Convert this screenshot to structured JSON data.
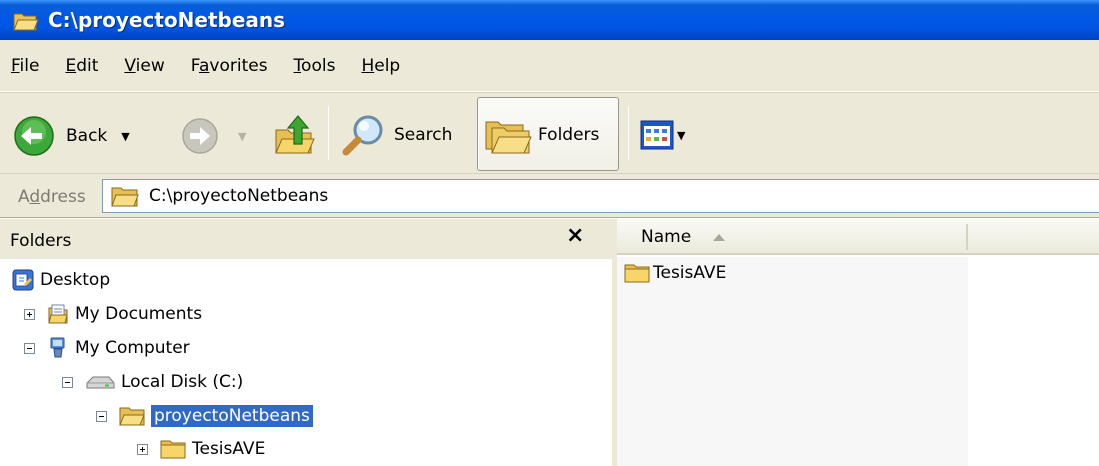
{
  "window": {
    "title": "C:\\proyectoNetbeans"
  },
  "menu": [
    {
      "label": "File",
      "accel": "F",
      "rest": "ile"
    },
    {
      "label": "Edit",
      "accel": "E",
      "rest": "dit"
    },
    {
      "label": "View",
      "accel": "V",
      "rest": "iew"
    },
    {
      "label": "Favorites",
      "pre": "F",
      "accel": "a",
      "rest": "vorites"
    },
    {
      "label": "Tools",
      "accel": "T",
      "rest": "ools"
    },
    {
      "label": "Help",
      "accel": "H",
      "rest": "elp"
    }
  ],
  "toolbar": {
    "back_label": "Back",
    "search_label": "Search",
    "folders_label": "Folders"
  },
  "address": {
    "label": "Address",
    "label_pre": "A",
    "label_accel": "d",
    "label_rest": "dress",
    "value": "C:\\proyectoNetbeans"
  },
  "folders_pane": {
    "title": "Folders",
    "close_glyph": "×",
    "tree": [
      {
        "label": "Desktop",
        "icon": "desktop-icon"
      },
      {
        "label": "My Documents",
        "icon": "my-documents-icon",
        "expander": "plus"
      },
      {
        "label": "My Computer",
        "icon": "my-computer-icon",
        "expander": "minus"
      },
      {
        "label": "Local Disk (C:)",
        "icon": "drive-icon",
        "expander": "minus"
      },
      {
        "label": "proyectoNetbeans",
        "icon": "folder-open-icon",
        "expander": "minus",
        "selected": true
      },
      {
        "label": "TesisAVE",
        "icon": "folder-icon",
        "expander": "plus"
      }
    ]
  },
  "file_list": {
    "columns": [
      {
        "label": "Name",
        "sort": "ascending"
      }
    ],
    "items": [
      {
        "name": "TesisAVE",
        "icon": "folder-icon"
      }
    ]
  },
  "colors": {
    "titlebar": "#0055e3",
    "chrome": "#ece9d8",
    "selection": "#316ac5",
    "folder": "#f6d66b"
  }
}
